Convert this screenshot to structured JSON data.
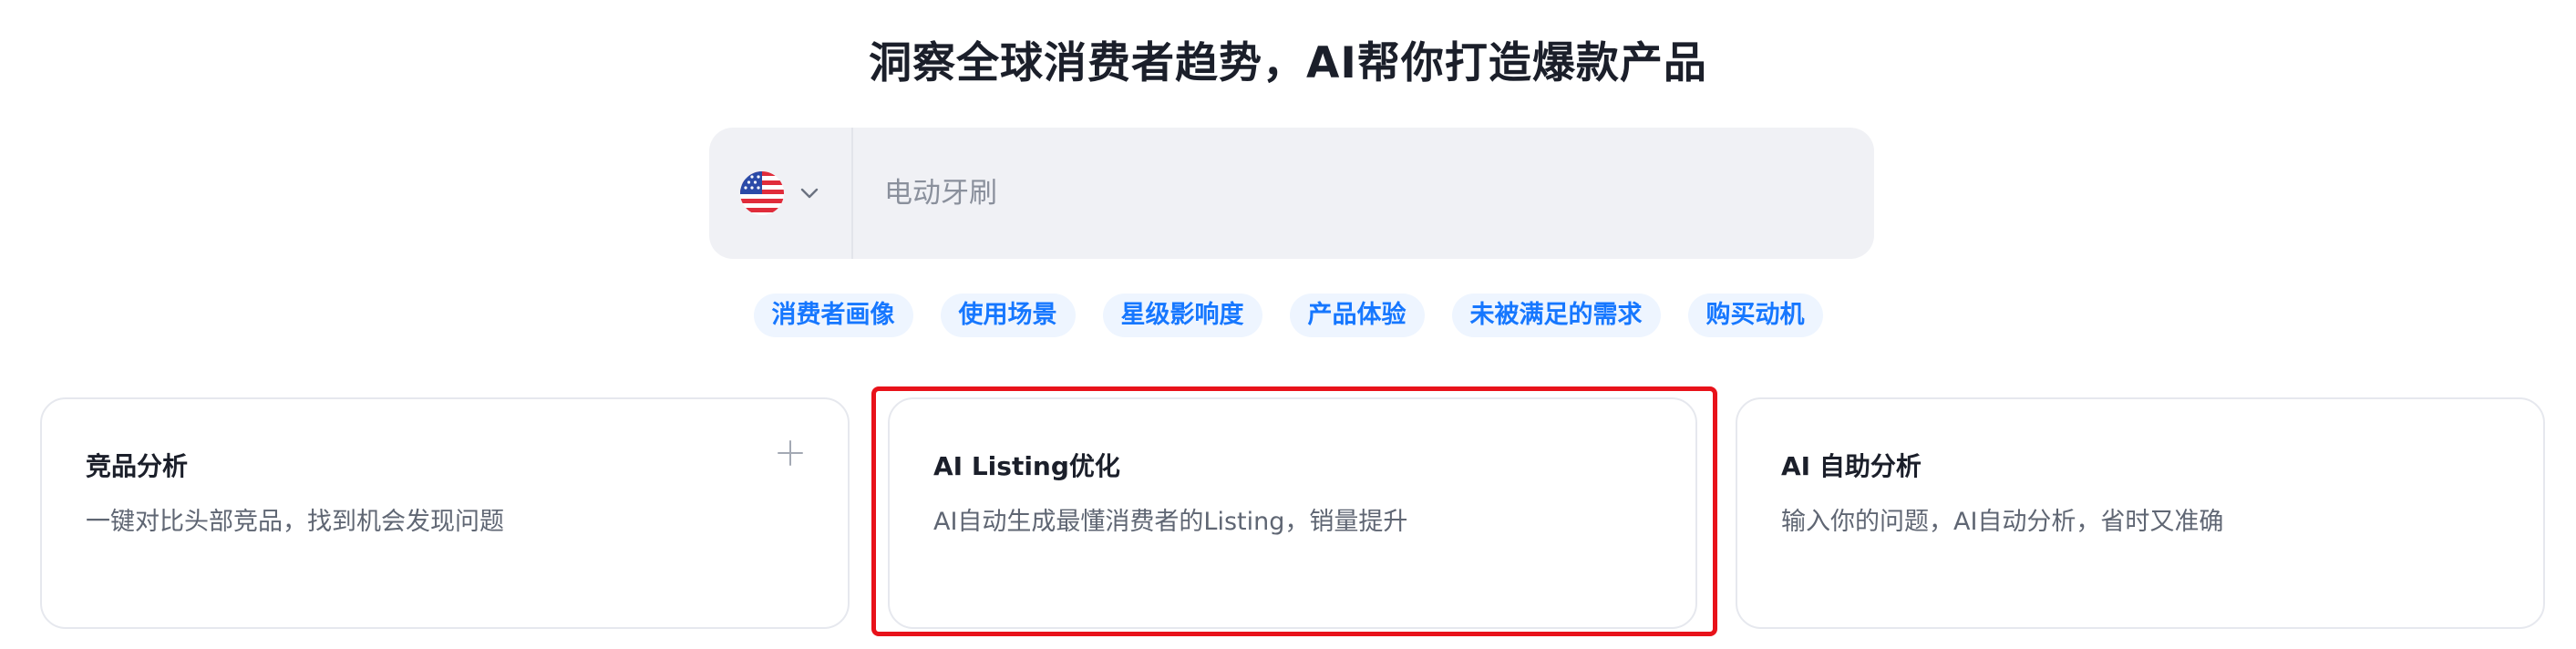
{
  "header": {
    "title": "洞察全球消费者趋势，AI帮你打造爆款产品"
  },
  "search": {
    "country_icon": "us-flag-icon",
    "dropdown_icon": "chevron-down-icon",
    "placeholder": "电动牙刷"
  },
  "tags": [
    {
      "label": "消费者画像"
    },
    {
      "label": "使用场景"
    },
    {
      "label": "星级影响度"
    },
    {
      "label": "产品体验"
    },
    {
      "label": "未被满足的需求"
    },
    {
      "label": "购买动机"
    }
  ],
  "cards": [
    {
      "title": "竞品分析",
      "desc": "一键对比头部竞品，找到机会发现问题",
      "icon": "plus-icon"
    },
    {
      "title": "AI Listing优化",
      "desc": "AI自动生成最懂消费者的Listing，销量提升"
    },
    {
      "title": "AI 自助分析",
      "desc": "输入你的问题，AI自动分析，省时又准确"
    }
  ],
  "colors": {
    "accent": "#1677ff",
    "tag_bg": "#eef5ff",
    "search_bg": "#f0f1f5",
    "highlight": "#e8121a"
  }
}
